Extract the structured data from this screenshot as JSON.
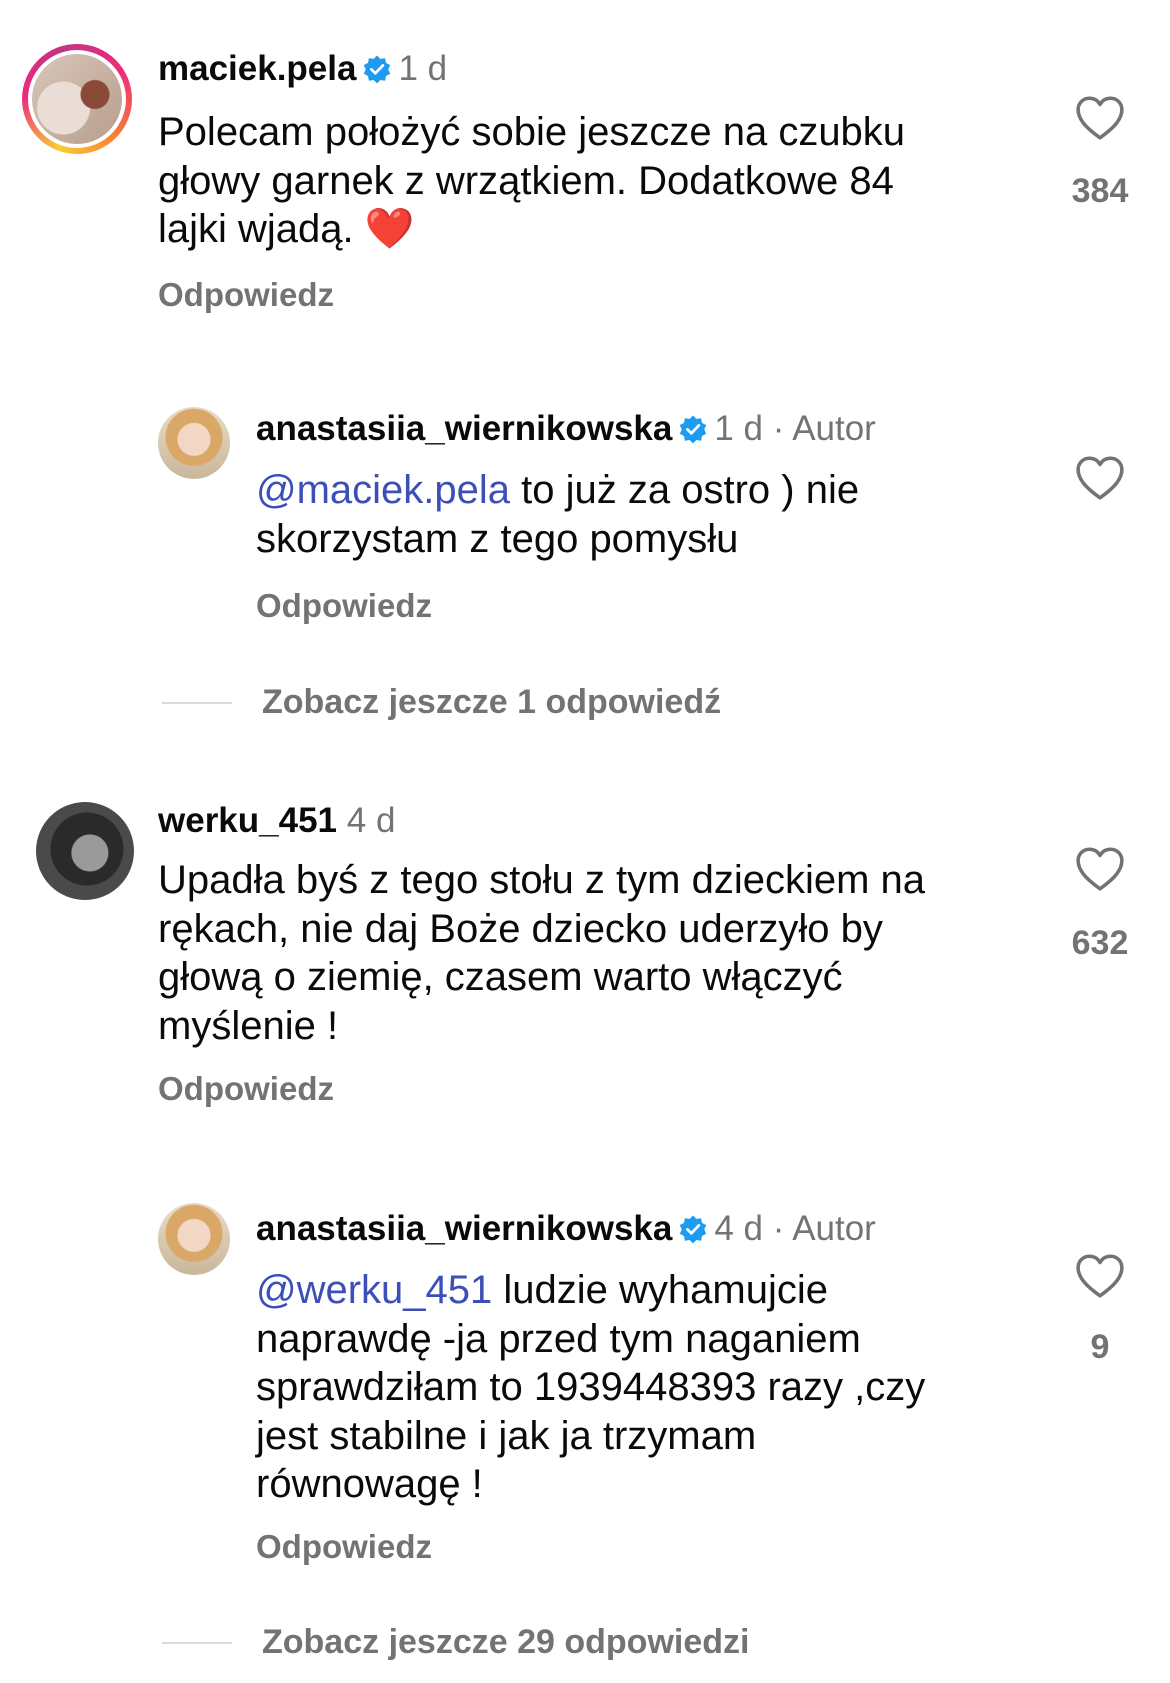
{
  "colors": {
    "text": "#0a0a0a",
    "secondary": "#737373",
    "mention": "#3c4fb8",
    "verified": "#1d9bf0"
  },
  "comments": [
    {
      "username": "maciek.pela",
      "verified": true,
      "time": "1 d",
      "text_lines": [
        "Polecam położyć sobie jeszcze na czubku",
        "głowy garnek z wrzątkiem. Dodatkowe 84",
        "lajki wjadą. "
      ],
      "emoji": "❤️",
      "reply_label": "Odpowiedz",
      "like_count": "384",
      "like_icon": "heart-outline-icon"
    },
    {
      "username": "anastasiia_wiernikowska",
      "verified": true,
      "time": "1 d",
      "author_sep": " · ",
      "author": "Autor",
      "mention": "@maciek.pela",
      "text_after_mention": " to już za ostro ) nie",
      "text_lines": [
        "skorzystam z tego pomysłu"
      ],
      "reply_label": "Odpowiedz",
      "like_icon": "heart-outline-icon"
    },
    {
      "username": "werku_451",
      "verified": false,
      "time": "4 d",
      "text_lines": [
        "Upadła byś z tego stołu z tym dzieckiem na",
        "rękach, nie daj Boże dziecko uderzyło by",
        "głową o ziemię, czasem warto włączyć",
        "myślenie !"
      ],
      "reply_label": "Odpowiedz",
      "like_count": "632",
      "like_icon": "heart-outline-icon"
    },
    {
      "username": "anastasiia_wiernikowska",
      "verified": true,
      "time": "4 d",
      "author_sep": " · ",
      "author": "Autor",
      "mention": "@werku_451",
      "text_after_mention": " ludzie wyhamujcie",
      "text_lines": [
        "naprawdę -ja przed tym naganiem",
        "sprawdziłam to 1939448393 razy ,czy",
        "jest stabilne i jak ja trzymam",
        "równowagę !"
      ],
      "reply_label": "Odpowiedz",
      "like_count": "9",
      "like_icon": "heart-outline-icon"
    }
  ],
  "view_more": [
    {
      "label": "Zobacz jeszcze 1 odpowiedź"
    },
    {
      "label": "Zobacz jeszcze 29 odpowiedzi"
    }
  ]
}
